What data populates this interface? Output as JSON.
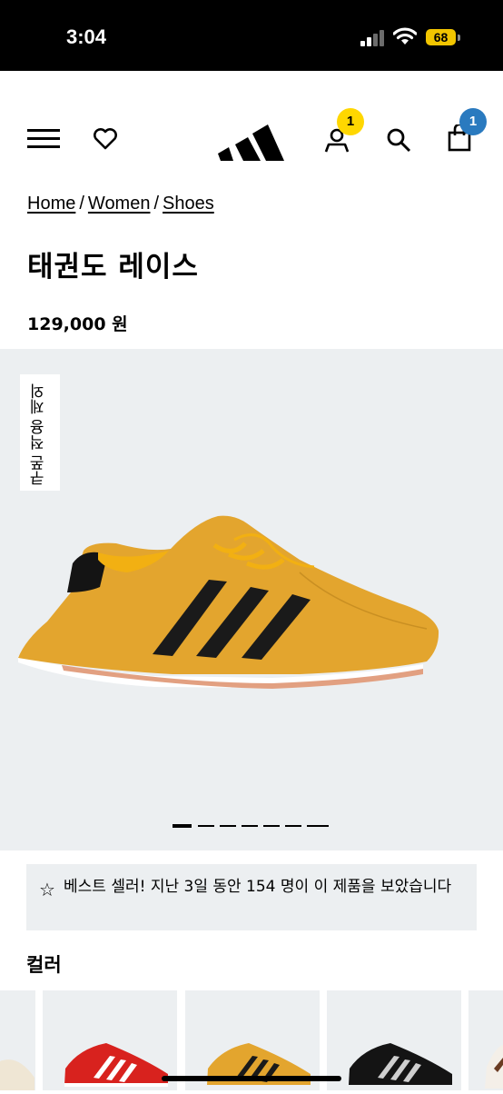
{
  "status": {
    "time": "3:04",
    "battery": "68"
  },
  "header": {
    "menu_icon": "hamburger-icon",
    "wishlist_icon": "heart-icon",
    "logo": "adidas",
    "account_badge": "1",
    "cart_badge": "1",
    "colors": {
      "account_badge": "#ffd700",
      "cart_badge": "#2a7abf"
    }
  },
  "breadcrumb": [
    "Home",
    "Women",
    "Shoes"
  ],
  "product": {
    "title": "태권도 레이스",
    "price": "129,000 원",
    "tag": "쿠폰 적용 제외",
    "image_count": 7,
    "active_image": 1
  },
  "best_seller": {
    "text": "베스트 셀러!  지난 3일 동안 154 명이 이 제품을 보았습니다"
  },
  "colors_section": {
    "heading": "컬러",
    "swatches": [
      "cream",
      "red",
      "yellow",
      "black",
      "white-brown"
    ]
  },
  "theme": {
    "background": "#ffffff",
    "gallery_bg": "#eceff1",
    "text": "#000000"
  }
}
